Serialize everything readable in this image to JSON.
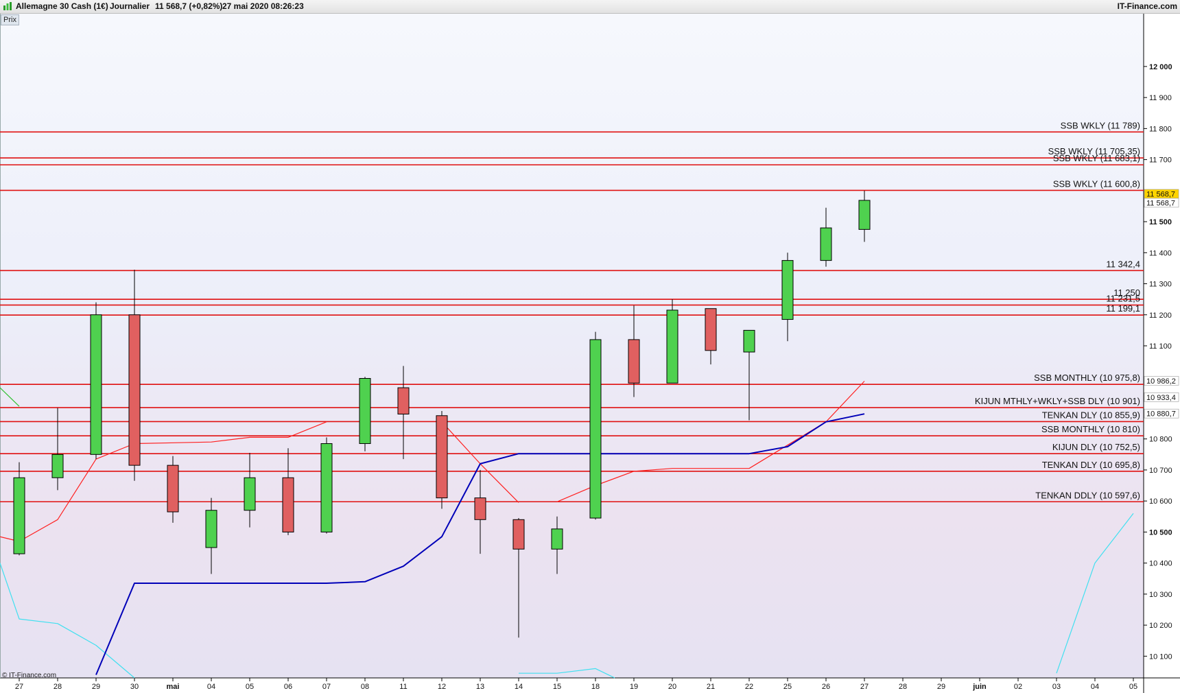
{
  "header": {
    "title": "Allemagne 30 Cash (1€)",
    "period": "Journalier",
    "price": "11 568,7 (+0,82%)",
    "timestamp": "27 mai 2020 08:26:23",
    "brand": "IT-Finance.com"
  },
  "panel": {
    "label": "Prix",
    "copyright": "© IT-Finance.com"
  },
  "colors": {
    "up": "#4fd14f",
    "down": "#e06060",
    "level": "#e01010",
    "kijun": "#0000b8",
    "tenkan": "#ff2020",
    "cloud_line": "#40e0f0",
    "chikou": "#30c030"
  },
  "chart_data": {
    "type": "candlestick",
    "ylim": [
      10030,
      12170
    ],
    "x_labels": [
      "27",
      "28",
      "29",
      "30",
      "mai",
      "04",
      "05",
      "06",
      "07",
      "08",
      "11",
      "12",
      "13",
      "14",
      "15",
      "18",
      "19",
      "20",
      "21",
      "22",
      "25",
      "26",
      "27",
      "28",
      "29",
      "juin",
      "02",
      "03",
      "04",
      "05"
    ],
    "y_ticks": [
      {
        "v": 12000,
        "label": "12 000",
        "bold": true
      },
      {
        "v": 11900,
        "label": "11 900",
        "bold": false
      },
      {
        "v": 11800,
        "label": "11 800",
        "bold": false
      },
      {
        "v": 11700,
        "label": "11 700",
        "bold": false
      },
      {
        "v": 11500,
        "label": "11 500",
        "bold": true
      },
      {
        "v": 11400,
        "label": "11 400",
        "bold": false
      },
      {
        "v": 11300,
        "label": "11 300",
        "bold": false
      },
      {
        "v": 11200,
        "label": "11 200",
        "bold": false
      },
      {
        "v": 11100,
        "label": "11 100",
        "bold": false
      },
      {
        "v": 10800,
        "label": "10 800",
        "bold": false
      },
      {
        "v": 10700,
        "label": "10 700",
        "bold": false
      },
      {
        "v": 10600,
        "label": "10 600",
        "bold": false
      },
      {
        "v": 10500,
        "label": "10 500",
        "bold": true
      },
      {
        "v": 10400,
        "label": "10 400",
        "bold": false
      },
      {
        "v": 10300,
        "label": "10 300",
        "bold": false
      },
      {
        "v": 10200,
        "label": "10 200",
        "bold": false
      },
      {
        "v": 10100,
        "label": "10 100",
        "bold": false
      }
    ],
    "candles": [
      {
        "x": "27",
        "o": 10430,
        "h": 10725,
        "l": 10425,
        "c": 10675
      },
      {
        "x": "28",
        "o": 10675,
        "h": 10900,
        "l": 10635,
        "c": 10750
      },
      {
        "x": "29",
        "o": 10750,
        "h": 11240,
        "l": 10735,
        "c": 11200
      },
      {
        "x": "30",
        "o": 11200,
        "h": 11345,
        "l": 10665,
        "c": 10715
      },
      {
        "x": "mai",
        "o": 10715,
        "h": 10745,
        "l": 10530,
        "c": 10565
      },
      {
        "x": "04",
        "o": 10450,
        "h": 10610,
        "l": 10365,
        "c": 10570
      },
      {
        "x": "05",
        "o": 10570,
        "h": 10755,
        "l": 10515,
        "c": 10675
      },
      {
        "x": "06",
        "o": 10675,
        "h": 10770,
        "l": 10490,
        "c": 10500
      },
      {
        "x": "07",
        "o": 10500,
        "h": 10805,
        "l": 10495,
        "c": 10785
      },
      {
        "x": "08",
        "o": 10785,
        "h": 11000,
        "l": 10760,
        "c": 10995
      },
      {
        "x": "11",
        "o": 10965,
        "h": 11035,
        "l": 10735,
        "c": 10880
      },
      {
        "x": "12",
        "o": 10875,
        "h": 10890,
        "l": 10575,
        "c": 10610
      },
      {
        "x": "13",
        "o": 10610,
        "h": 10700,
        "l": 10430,
        "c": 10540
      },
      {
        "x": "14",
        "o": 10540,
        "h": 10545,
        "l": 10160,
        "c": 10445
      },
      {
        "x": "15",
        "o": 10445,
        "h": 10550,
        "l": 10365,
        "c": 10510
      },
      {
        "x": "18",
        "o": 10545,
        "h": 11145,
        "l": 10540,
        "c": 11120
      },
      {
        "x": "19",
        "o": 11120,
        "h": 11230,
        "l": 10935,
        "c": 10980
      },
      {
        "x": "20",
        "o": 10980,
        "h": 11250,
        "l": 10980,
        "c": 11215
      },
      {
        "x": "21",
        "o": 11220,
        "h": 11220,
        "l": 11040,
        "c": 11085
      },
      {
        "x": "22",
        "o": 11080,
        "h": 11150,
        "l": 10860,
        "c": 11150
      },
      {
        "x": "25",
        "o": 11185,
        "h": 11400,
        "l": 11115,
        "c": 11375
      },
      {
        "x": "26",
        "o": 11375,
        "h": 11545,
        "l": 11355,
        "c": 11480
      },
      {
        "x": "27",
        "o": 11475,
        "h": 11600,
        "l": 11435,
        "c": 11568.7
      }
    ],
    "kijun": [
      {
        "i": 2.0,
        "v": 10040
      },
      {
        "i": 3,
        "v": 10335
      },
      {
        "i": 8,
        "v": 10335
      },
      {
        "i": 9,
        "v": 10340
      },
      {
        "i": 10,
        "v": 10390
      },
      {
        "i": 11,
        "v": 10485
      },
      {
        "i": 12,
        "v": 10720
      },
      {
        "i": 13,
        "v": 10752.5
      },
      {
        "i": 19,
        "v": 10752.5
      },
      {
        "i": 20,
        "v": 10775
      },
      {
        "i": 21,
        "v": 10855
      },
      {
        "i": 22,
        "v": 10880.7
      }
    ],
    "tenkan": [
      {
        "i": -0.5,
        "v": 10485
      },
      {
        "i": 0,
        "v": 10470
      },
      {
        "i": 1,
        "v": 10540
      },
      {
        "i": 2,
        "v": 10735
      },
      {
        "i": 3,
        "v": 10785
      },
      {
        "i": 5,
        "v": 10790
      },
      {
        "i": 6,
        "v": 10805
      },
      {
        "i": 7,
        "v": 10805
      },
      {
        "i": 8,
        "v": 10855
      },
      {
        "i": null,
        "v": null
      },
      {
        "i": 11,
        "v": 10855
      },
      {
        "i": 12,
        "v": 10720
      },
      {
        "i": 13,
        "v": 10595
      },
      {
        "i": null,
        "v": null
      },
      {
        "i": 14,
        "v": 10597.6
      },
      {
        "i": 15,
        "v": 10650
      },
      {
        "i": 16,
        "v": 10695.8
      },
      {
        "i": 17,
        "v": 10705
      },
      {
        "i": 19,
        "v": 10705
      },
      {
        "i": 20,
        "v": 10780
      },
      {
        "i": 21,
        "v": 10855
      },
      {
        "i": 22,
        "v": 10986.2
      }
    ],
    "cloud_line": [
      {
        "i": -0.5,
        "v": 10400
      },
      {
        "i": 0,
        "v": 10220
      },
      {
        "i": 1,
        "v": 10205
      },
      {
        "i": 2,
        "v": 10135
      },
      {
        "i": 3,
        "v": 10030
      },
      {
        "i": null,
        "v": null
      },
      {
        "i": 13,
        "v": 10045
      },
      {
        "i": 14,
        "v": 10045
      },
      {
        "i": 15,
        "v": 10060
      },
      {
        "i": 15.5,
        "v": 10030
      },
      {
        "i": null,
        "v": null
      },
      {
        "i": 27,
        "v": 10045
      },
      {
        "i": 28,
        "v": 10400
      },
      {
        "i": 29,
        "v": 10560
      }
    ],
    "chikou": [
      {
        "i": -0.5,
        "v": 10965
      },
      {
        "i": 0,
        "v": 10905
      }
    ],
    "levels": [
      {
        "v": 11789,
        "label": "SSB WKLY (11 789)"
      },
      {
        "v": 11705.35,
        "label": "SSB WKLY (11 705,35)"
      },
      {
        "v": 11683.1,
        "label": "SSB WKLY (11 683,1)"
      },
      {
        "v": 11600.8,
        "label": "SSB WKLY (11 600,8)"
      },
      {
        "v": 11342.4,
        "label": "11 342,4"
      },
      {
        "v": 11250,
        "label": "11 250"
      },
      {
        "v": 11231.5,
        "label": "11 231,5"
      },
      {
        "v": 11199.1,
        "label": "11 199,1"
      },
      {
        "v": 10975.8,
        "label": "SSB MONTHLY (10 975,8)"
      },
      {
        "v": 10901,
        "label": "KIJUN MTHLY+WKLY+SSB DLY (10 901)"
      },
      {
        "v": 10855.9,
        "label": "TENKAN DLY (10 855,9)"
      },
      {
        "v": 10810,
        "label": "SSB MONTHLY (10 810)"
      },
      {
        "v": 10752.5,
        "label": "KIJUN DLY (10 752,5)"
      },
      {
        "v": 10695.8,
        "label": "TENKAN DLY (10 695,8)"
      },
      {
        "v": 10597.6,
        "label": "TENKAN DDLY (10 597,6)"
      }
    ],
    "price_tags": [
      {
        "v": 11568.7,
        "label": "11 568,7",
        "bg": "#ffd400",
        "fg": "#000000",
        "dy": -9
      },
      {
        "v": 11568.7,
        "label": "11 568,7",
        "bg": "#ffffff",
        "fg": "#5050b0",
        "dy": 4
      },
      {
        "v": 10986.2,
        "label": "10 986,2",
        "bg": "#ffffff",
        "fg": "#e01010",
        "dy": 0
      },
      {
        "v": 10933.4,
        "label": "10 933,4",
        "bg": "#ffffff",
        "fg": "#20b8c8",
        "dy": 0
      },
      {
        "v": 10880.7,
        "label": "10 880,7",
        "bg": "#ffffff",
        "fg": "#0000b8",
        "dy": 0
      }
    ]
  }
}
